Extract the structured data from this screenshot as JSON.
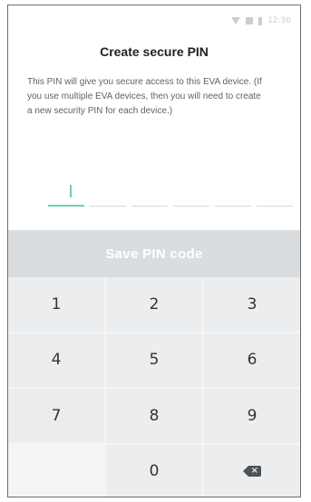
{
  "status_bar": {
    "time": "12:30",
    "icons": [
      "wifi-icon",
      "signal-icon",
      "battery-icon"
    ]
  },
  "header": {
    "title": "Create secure PIN"
  },
  "description": "This PIN will give you secure access to this EVA device. (If you use multiple EVA devices, then you will need to create a new security PIN for each device.)",
  "pin": {
    "length": 6,
    "filled": 0
  },
  "save_button": {
    "label": "Save PIN code"
  },
  "keypad": {
    "keys": [
      "1",
      "2",
      "3",
      "4",
      "5",
      "6",
      "7",
      "8",
      "9",
      "",
      "0",
      "backspace-icon"
    ]
  },
  "colors": {
    "accent": "#6fcfb8",
    "button_disabled": "#d9dde0",
    "key_bg": "#ebedef"
  }
}
